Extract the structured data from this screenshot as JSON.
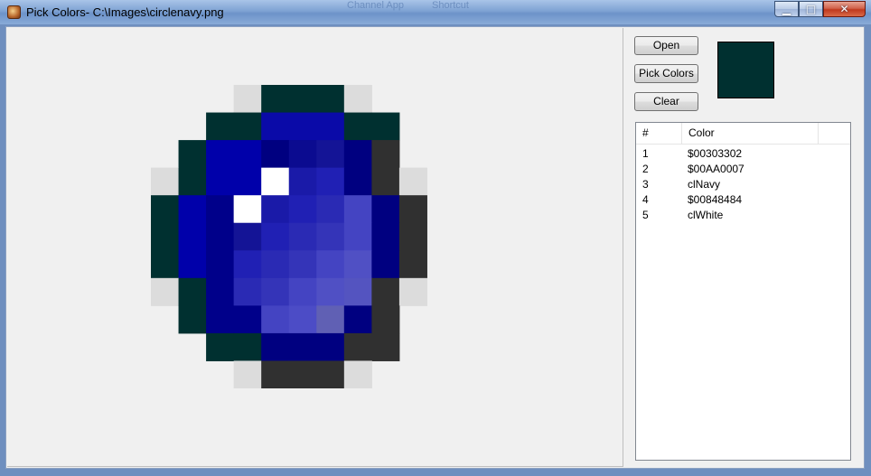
{
  "window": {
    "title": "Pick Colors- C:\\Images\\circlenavy.png",
    "minimize_glyph": "▁",
    "maximize_glyph": "□",
    "close_glyph": "✕"
  },
  "background_titles": [
    "Channel App",
    "Shortcut"
  ],
  "buttons": {
    "open": "Open",
    "pick_colors": "Pick Colors",
    "clear": "Clear"
  },
  "selected_color_swatch": "#003030",
  "list": {
    "columns": [
      "#",
      "Color"
    ],
    "rows": [
      {
        "num": "1",
        "color": "$00303302"
      },
      {
        "num": "2",
        "color": "$00AA0007"
      },
      {
        "num": "3",
        "color": "clNavy"
      },
      {
        "num": "4",
        "color": "$00848484"
      },
      {
        "num": "5",
        "color": "clWhite"
      }
    ]
  },
  "image_pixels": {
    "palette": {
      ".": "none",
      "g": "#dcdcdc",
      "t": "#003030",
      "d": "#303030",
      "N": "#000080",
      "B": "#0000aa",
      "K": "#0a0aa8",
      "n": "#00008a",
      "W": "#ffffff",
      "a": "#0b0b90",
      "b": "#141496",
      "c": "#1a1aa8",
      "e": "#2020b4",
      "f": "#2a2ab4",
      "h": "#3434b8",
      "i": "#3c3cbe",
      "j": "#4444c2",
      "k": "#4c4cc6",
      "l": "#5050c4",
      "m": "#5454c0",
      "o": "#5c5cbc",
      "p": "#6060b4",
      "q": "#6868b8"
    },
    "rows": [
      "...gtttg...",
      "..ttKKKtt..",
      ".tBBNabNd..",
      "gtBBWceNdg.",
      "tBnWcefjNd.",
      "tBnbefhjNd.",
      "tBnefhjlNd.",
      "gtnfhjlmdg.",
      ".tnnjkpNd..",
      "..ttNNNdd..",
      "...gdddg..."
    ]
  }
}
